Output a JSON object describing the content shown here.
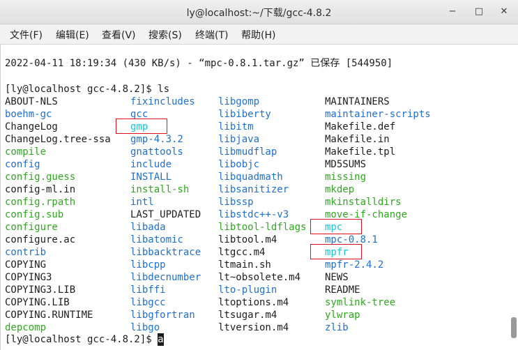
{
  "window": {
    "title": "ly@localhost:~/下载/gcc-4.8.2",
    "minimize_glyph": "−",
    "maximize_glyph": "□",
    "close_glyph": "✕"
  },
  "menu": [
    "文件(F)",
    "编辑(E)",
    "查看(V)",
    "搜索(S)",
    "终端(T)",
    "帮助(H)"
  ],
  "terminal": {
    "download_line": "2022-04-11 18:19:34 (430 KB/s) - “mpc-0.8.1.tar.gz” 已保存 [544950]",
    "prompt1": "[ly@localhost gcc-4.8.2]$ ls",
    "prompt2": "[ly@localhost gcc-4.8.2]$ ",
    "typed": "a"
  },
  "colors": {
    "dir": "#1f6fd1",
    "exec": "#2ea81d",
    "link": "#11c8d8",
    "text": "#1d1d1d",
    "highlight_box": "#e0101a"
  },
  "listing": [
    [
      {
        "t": "ABOUT-NLS",
        "k": "file"
      },
      {
        "t": "fixincludes",
        "k": "dir"
      },
      {
        "t": "libgomp",
        "k": "dir"
      },
      {
        "t": "MAINTAINERS",
        "k": "file"
      }
    ],
    [
      {
        "t": "boehm-gc",
        "k": "dir"
      },
      {
        "t": "gcc",
        "k": "dir"
      },
      {
        "t": "libiberty",
        "k": "dir"
      },
      {
        "t": "maintainer-scripts",
        "k": "dir"
      }
    ],
    [
      {
        "t": "ChangeLog",
        "k": "file"
      },
      {
        "t": "gmp",
        "k": "link"
      },
      {
        "t": "libitm",
        "k": "dir"
      },
      {
        "t": "Makefile.def",
        "k": "file"
      }
    ],
    [
      {
        "t": "ChangeLog.tree-ssa",
        "k": "file"
      },
      {
        "t": "gmp-4.3.2",
        "k": "dir"
      },
      {
        "t": "libjava",
        "k": "dir"
      },
      {
        "t": "Makefile.in",
        "k": "file"
      }
    ],
    [
      {
        "t": "compile",
        "k": "exec"
      },
      {
        "t": "gnattools",
        "k": "dir"
      },
      {
        "t": "libmudflap",
        "k": "dir"
      },
      {
        "t": "Makefile.tpl",
        "k": "file"
      }
    ],
    [
      {
        "t": "config",
        "k": "dir"
      },
      {
        "t": "include",
        "k": "dir"
      },
      {
        "t": "libobjc",
        "k": "dir"
      },
      {
        "t": "MD5SUMS",
        "k": "file"
      }
    ],
    [
      {
        "t": "config.guess",
        "k": "exec"
      },
      {
        "t": "INSTALL",
        "k": "dir"
      },
      {
        "t": "libquadmath",
        "k": "dir"
      },
      {
        "t": "missing",
        "k": "exec"
      }
    ],
    [
      {
        "t": "config-ml.in",
        "k": "file"
      },
      {
        "t": "install-sh",
        "k": "exec"
      },
      {
        "t": "libsanitizer",
        "k": "dir"
      },
      {
        "t": "mkdep",
        "k": "exec"
      }
    ],
    [
      {
        "t": "config.rpath",
        "k": "exec"
      },
      {
        "t": "intl",
        "k": "dir"
      },
      {
        "t": "libssp",
        "k": "dir"
      },
      {
        "t": "mkinstalldirs",
        "k": "exec"
      }
    ],
    [
      {
        "t": "config.sub",
        "k": "exec"
      },
      {
        "t": "LAST_UPDATED",
        "k": "file"
      },
      {
        "t": "libstdc++-v3",
        "k": "dir"
      },
      {
        "t": "move-if-change",
        "k": "exec"
      }
    ],
    [
      {
        "t": "configure",
        "k": "exec"
      },
      {
        "t": "libada",
        "k": "dir"
      },
      {
        "t": "libtool-ldflags",
        "k": "exec"
      },
      {
        "t": "mpc",
        "k": "link"
      }
    ],
    [
      {
        "t": "configure.ac",
        "k": "file"
      },
      {
        "t": "libatomic",
        "k": "dir"
      },
      {
        "t": "libtool.m4",
        "k": "file"
      },
      {
        "t": "mpc-0.8.1",
        "k": "dir"
      }
    ],
    [
      {
        "t": "contrib",
        "k": "dir"
      },
      {
        "t": "libbacktrace",
        "k": "dir"
      },
      {
        "t": "ltgcc.m4",
        "k": "file"
      },
      {
        "t": "mpfr",
        "k": "link"
      }
    ],
    [
      {
        "t": "COPYING",
        "k": "file"
      },
      {
        "t": "libcpp",
        "k": "dir"
      },
      {
        "t": "ltmain.sh",
        "k": "file"
      },
      {
        "t": "mpfr-2.4.2",
        "k": "dir"
      }
    ],
    [
      {
        "t": "COPYING3",
        "k": "file"
      },
      {
        "t": "libdecnumber",
        "k": "dir"
      },
      {
        "t": "lt~obsolete.m4",
        "k": "file"
      },
      {
        "t": "NEWS",
        "k": "file"
      }
    ],
    [
      {
        "t": "COPYING3.LIB",
        "k": "file"
      },
      {
        "t": "libffi",
        "k": "dir"
      },
      {
        "t": "lto-plugin",
        "k": "dir"
      },
      {
        "t": "README",
        "k": "file"
      }
    ],
    [
      {
        "t": "COPYING.LIB",
        "k": "file"
      },
      {
        "t": "libgcc",
        "k": "dir"
      },
      {
        "t": "ltoptions.m4",
        "k": "file"
      },
      {
        "t": "symlink-tree",
        "k": "exec"
      }
    ],
    [
      {
        "t": "COPYING.RUNTIME",
        "k": "file"
      },
      {
        "t": "libgfortran",
        "k": "dir"
      },
      {
        "t": "ltsugar.m4",
        "k": "file"
      },
      {
        "t": "ylwrap",
        "k": "exec"
      }
    ],
    [
      {
        "t": "depcomp",
        "k": "exec"
      },
      {
        "t": "libgo",
        "k": "dir"
      },
      {
        "t": "ltversion.m4",
        "k": "file"
      },
      {
        "t": "zlib",
        "k": "dir"
      }
    ]
  ],
  "highlighted": [
    "gmp",
    "mpc",
    "mpfr"
  ]
}
